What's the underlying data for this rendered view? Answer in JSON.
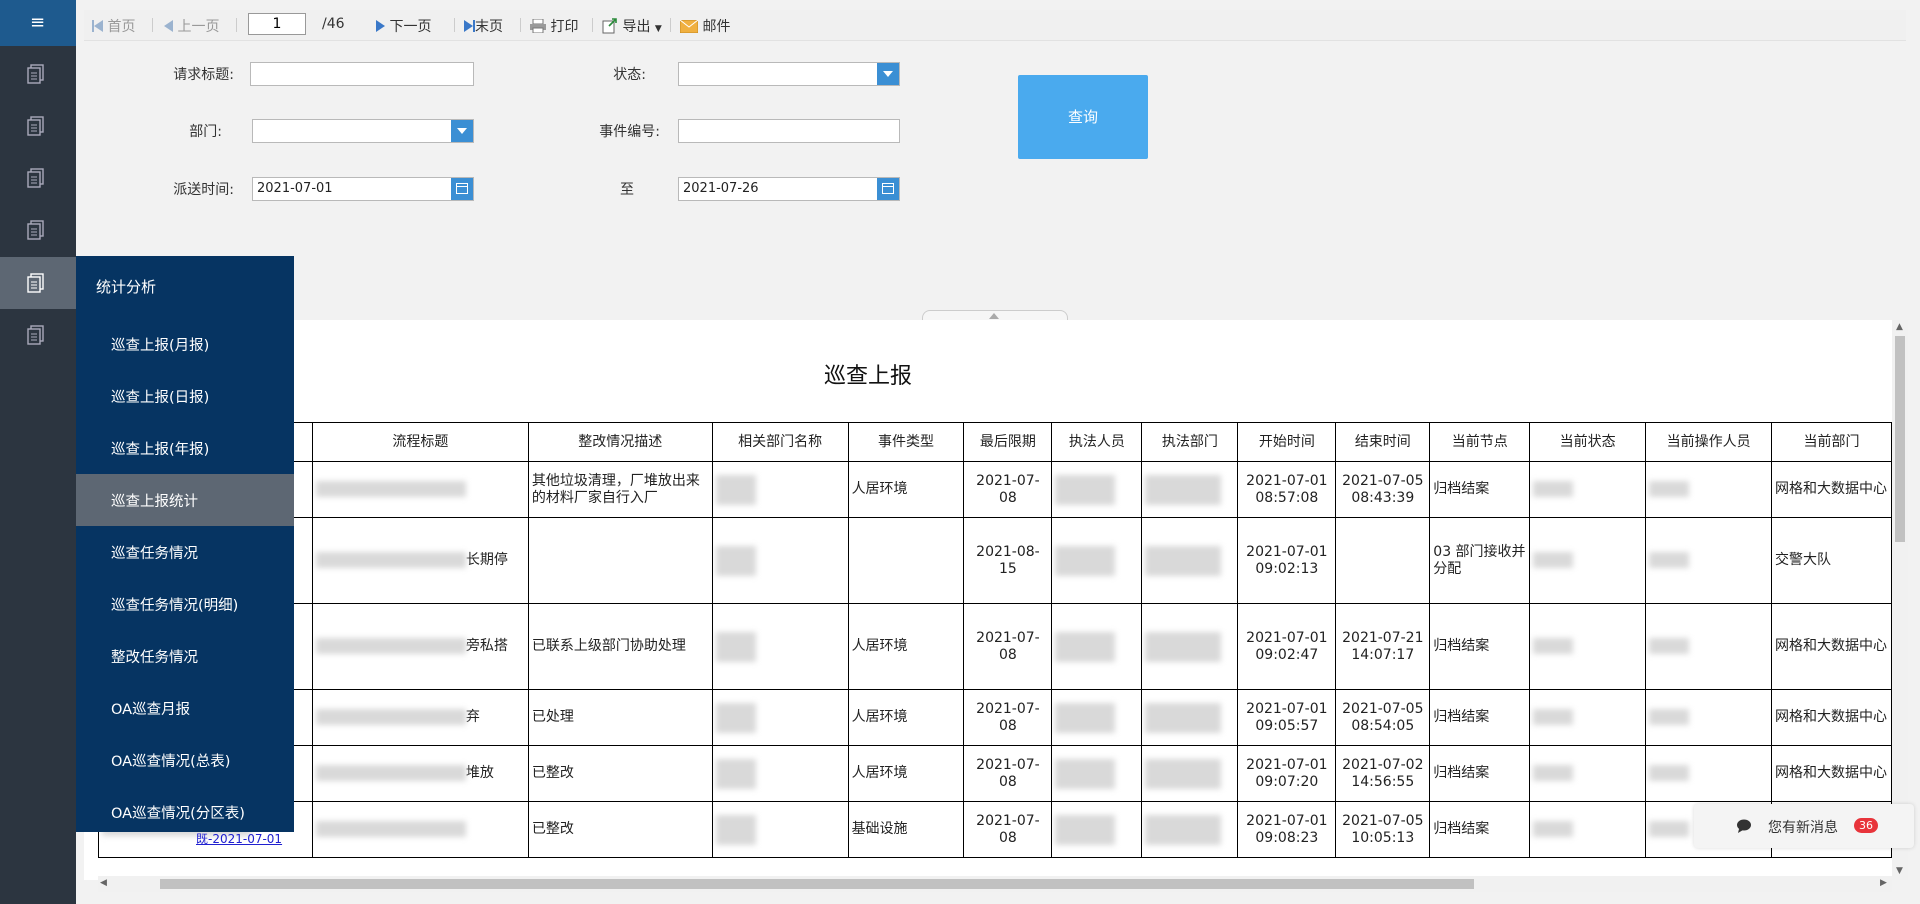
{
  "toolbar": {
    "first": "首页",
    "prev": "上一页",
    "page_value": "1",
    "page_total": "/46",
    "next": "下一页",
    "last": "末页",
    "print": "打印",
    "export": "导出",
    "mail": "邮件"
  },
  "filters": {
    "title_label": "请求标题:",
    "status_label": "状态:",
    "dept_label": "部门:",
    "event_no_label": "事件编号:",
    "dispatch_label": "派送时间:",
    "to_label": "至",
    "date_from": "2021-07-01",
    "date_to": "2021-07-26",
    "query_button": "查询"
  },
  "report": {
    "title": "巡查上报",
    "headers": [
      "流程标题",
      "整改情况描述",
      "相关部门名称",
      "事件类型",
      "最后限期",
      "执法人员",
      "执法部门",
      "开始时间",
      "结束时间",
      "当前节点",
      "当前状态",
      "当前操作人员",
      "当前部门"
    ],
    "rows": [
      {
        "title_suffix": "",
        "desc": "其他垃圾清理，厂堆放出来的材料厂家自行入厂",
        "type": "人居环境",
        "deadline": "2021-07-08",
        "start": "2021-07-01 08:57:08",
        "end": "2021-07-05 08:43:39",
        "node": "归档结案",
        "dept": "网格和大数据中心"
      },
      {
        "title_suffix": "长期停",
        "desc": "",
        "type": "",
        "deadline": "2021-08-15",
        "start": "2021-07-01 09:02:13",
        "end": "",
        "node": "03 部门接收并分配",
        "dept": "交警大队"
      },
      {
        "title_suffix": "旁私搭",
        "desc": "已联系上级部门协助处理",
        "type": "人居环境",
        "deadline": "2021-07-08",
        "start": "2021-07-01 09:02:47",
        "end": "2021-07-21 14:07:17",
        "node": "归档结案",
        "dept": "网格和大数据中心"
      },
      {
        "title_suffix": "弃",
        "desc": "已处理",
        "type": "人居环境",
        "deadline": "2021-07-08",
        "start": "2021-07-01 09:05:57",
        "end": "2021-07-05 08:54:05",
        "node": "归档结案",
        "dept": "网格和大数据中心"
      },
      {
        "title_suffix": "堆放",
        "desc": "已整改",
        "type": "人居环境",
        "deadline": "2021-07-08",
        "start": "2021-07-01 09:07:20",
        "end": "2021-07-02 14:56:55",
        "node": "归档结案",
        "dept": "网格和大数据中心"
      },
      {
        "title_suffix": "",
        "desc": "已整改",
        "type": "基础设施",
        "deadline": "2021-07-08",
        "start": "2021-07-01 09:08:23",
        "end": "2021-07-05 10:05:13",
        "node": "归档结案",
        "dept": ""
      }
    ],
    "partial_link": "既-2021-07-01"
  },
  "flyout": {
    "header": "统计分析",
    "items": [
      "巡查上报(月报)",
      "巡查上报(日报)",
      "巡查上报(年报)",
      "巡查上报统计",
      "巡查任务情况",
      "巡查任务情况(明细)",
      "整改任务情况",
      "OA巡查月报",
      "OA巡查情况(总表)",
      "OA巡查情况(分区表)"
    ],
    "active_index": 3
  },
  "message": {
    "text": "您有新消息",
    "count": "36"
  }
}
